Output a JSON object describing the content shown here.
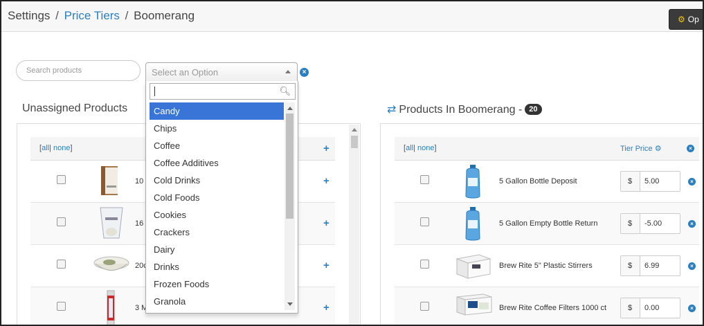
{
  "breadcrumb": {
    "root": "Settings",
    "link": "Price Tiers",
    "current": "Boomerang",
    "separator": "/"
  },
  "header": {
    "options_label": "Op"
  },
  "search": {
    "placeholder": "Search products"
  },
  "category_select": {
    "placeholder": "Select an Option",
    "options": [
      "Candy",
      "Chips",
      "Coffee",
      "Coffee Additives",
      "Cold Drinks",
      "Cold Foods",
      "Cookies",
      "Crackers",
      "Dairy",
      "Drinks",
      "Frozen Foods",
      "Granola"
    ],
    "highlighted": "Candy"
  },
  "unassigned": {
    "title": "Unassigned Products",
    "select_all": "all",
    "select_none": "none",
    "rows": [
      {
        "name": "10"
      },
      {
        "name": "16"
      },
      {
        "name": "20c"
      },
      {
        "name": "3 M"
      }
    ]
  },
  "assigned": {
    "title": "Products In Boomerang -",
    "count": "20",
    "select_all": "all",
    "select_none": "none",
    "tier_price_label": "Tier Price",
    "currency": "$",
    "rows": [
      {
        "name": "5 Gallon Bottle Deposit",
        "price": "5.00"
      },
      {
        "name": "5 Gallon Empty Bottle Return",
        "price": "-5.00"
      },
      {
        "name": "Brew Rite 5\" Plastic Stirrers",
        "price": "6.99"
      },
      {
        "name": "Brew Rite Coffee Filters 1000 ct",
        "price": "0.00"
      }
    ]
  },
  "icons": {
    "gear": "gear-icon",
    "clear": "clear-icon",
    "search": "search-icon",
    "swap": "swap-icon",
    "add": "plus-icon",
    "remove": "remove-icon"
  },
  "colors": {
    "accent": "#2a7fc1",
    "highlight": "#3875d7",
    "badge": "#333333",
    "gear": "#f0c419"
  }
}
